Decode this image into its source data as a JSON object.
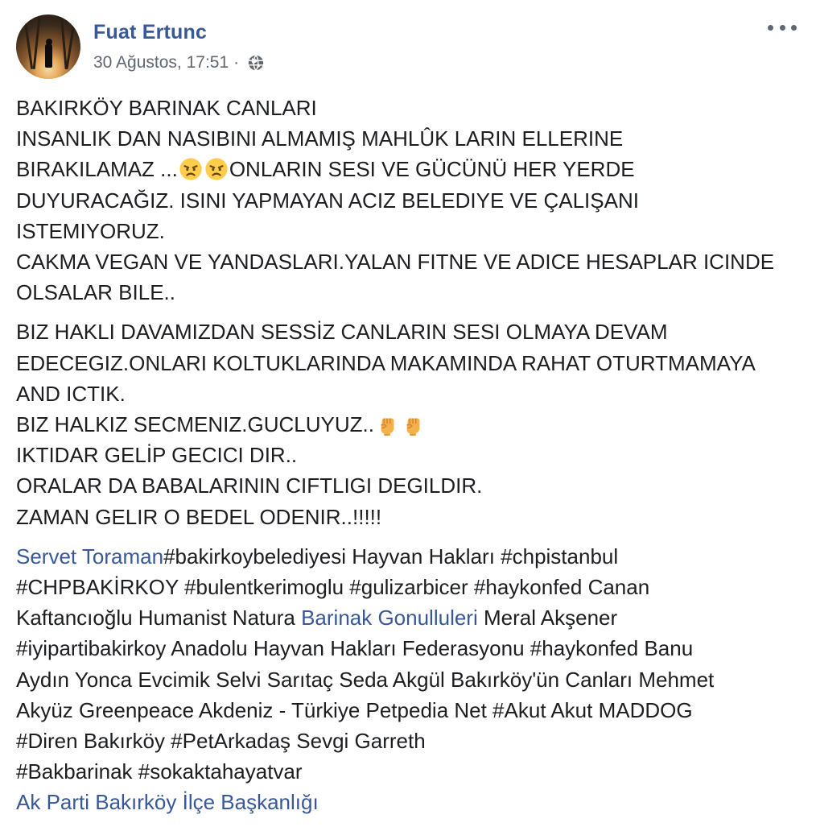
{
  "post": {
    "author": "Fuat Ertunc",
    "timestamp": "30 Ağustos, 17:51",
    "separator": "·",
    "privacy_icon": "globe-icon",
    "more_icon": "more-options-icon",
    "paragraph1": {
      "l1": "BAKIRKÖY BARINAK CANLARI",
      "l2": "INSANLIK DAN NASIBINI ALMAMIŞ MAHLÛK LARIN ELLERINE",
      "l3a": "BIRAKILAMAZ ...",
      "l3_emoji": "angry-face",
      "l3b": "ONLARIN SESI VE GÜCÜNÜ HER YERDE",
      "l4": "DUYURACAĞIZ. ISINI YAPMAYAN ACIZ BELEDIYE VE ÇALIŞANI",
      "l5": "ISTEMIYORUZ.",
      "l6": "CAKMA VEGAN VE YANDASLARI.YALAN FITNE VE ADICE HESAPLAR ICINDE",
      "l7": "OLSALAR BILE.."
    },
    "paragraph2": {
      "l1": "BIZ HAKLI DAVAMIZDAN SESSİZ CANLARIN SESI OLMAYA DEVAM",
      "l2": "EDECEGIZ.ONLARI KOLTUKLARINDA MAKAMINDA RAHAT OTURTMAMAYA",
      "l3": "AND ICTIK.",
      "l4": "BIZ HALKIZ SECMENIZ.GUCLUYUZ..",
      "l4_emoji": "raised-fist",
      "l5": "IKTIDAR GELİP GECICI DIR..",
      "l6": "ORALAR DA BABALARININ CIFTLIGI DEGILDIR.",
      "l7": "ZAMAN GELIR O BEDEL ODENIR..!!!!!"
    },
    "paragraph3": {
      "link1": "Servet Toraman",
      "l1_rest": "#bakirkoybelediyesi Hayvan Hakları #chpistanbul",
      "l2": "#CHPBAKİRKOY #bulentkerimoglu #gulizarbicer #haykonfed Canan",
      "l3a": "Kaftancıoğlu Humanist Natura ",
      "link2": "Barinak Gonulluleri",
      "l3b": " Meral Akşener",
      "l4": "#iyipartibakirkoy Anadolu Hayvan Hakları Federasyonu #haykonfed Banu",
      "l5": "Aydın Yonca Evcimik Selvi Sarıtaç Seda Akgül Bakırköy'ün Canları Mehmet",
      "l6": "Akyüz Greenpeace Akdeniz - Türkiye Petpedia Net #Akut Akut MADDOG",
      "l7": "#Diren Bakırköy #PetArkadaş Sevgi Garreth",
      "l8": "#Bakbarinak #sokaktahayatvar",
      "link3": "Ak Parti Bakırköy İlçe Başkanlığı"
    },
    "colors": {
      "link": "#385898",
      "text": "#1c1e21",
      "meta": "#616770"
    }
  }
}
